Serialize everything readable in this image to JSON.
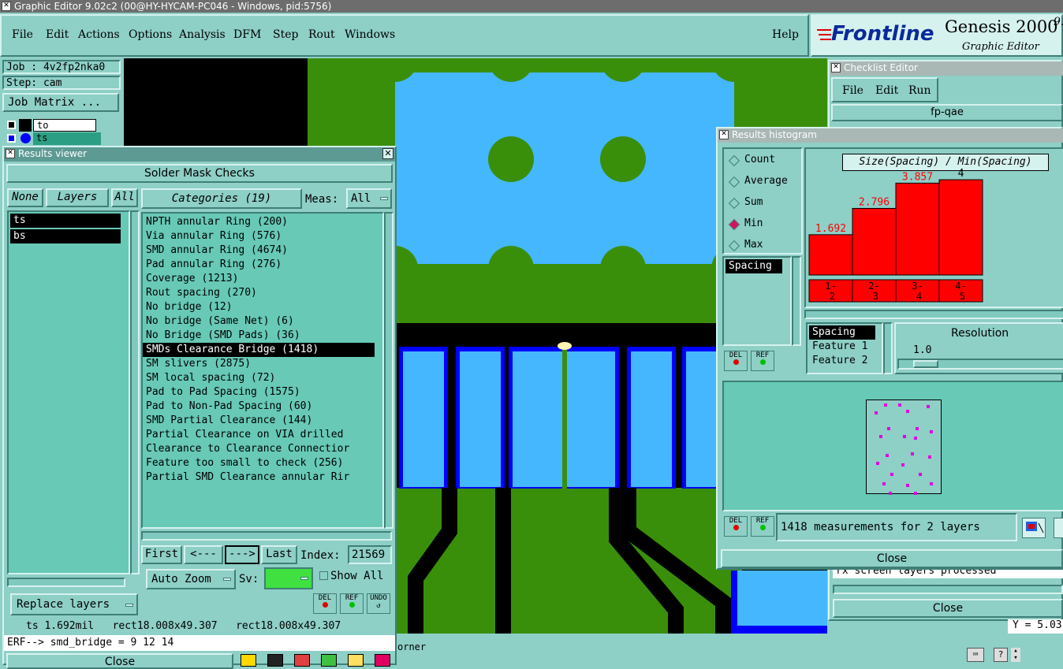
{
  "window": {
    "title": "Graphic Editor 9.02c2 (00@HY-HYCAM-PC046 - Windows, pid:5756)"
  },
  "menu": {
    "items": [
      "File",
      "Edit",
      "Actions",
      "Options",
      "Analysis",
      "DFM",
      "Step",
      "Rout",
      "Windows"
    ],
    "help": "Help"
  },
  "brand": {
    "logo": "Frontline",
    "product": "Genesis 2000",
    "version_fragment": "9.",
    "subtitle": "Graphic Editor"
  },
  "job_panel": {
    "job": "Job : 4v2fp2nka0",
    "step": "Step: cam",
    "matrix_button": "Job Matrix ...",
    "layer1": "to",
    "layer2": "ts"
  },
  "results_viewer": {
    "title": "Results viewer",
    "header": "Solder Mask Checks",
    "none_btn": "None",
    "layers_btn": "Layers",
    "all_btn": "All",
    "categories_btn": "Categories (19)",
    "meas_label": "Meas:",
    "meas_value": "All",
    "layers": [
      "ts",
      "bs"
    ],
    "categories": [
      "NPTH annular Ring (200)",
      "Via annular Ring (576)",
      "SMD annular Ring (4674)",
      "Pad annular Ring (276)",
      "Coverage (1213)",
      "Rout spacing (270)",
      "No bridge (12)",
      "No bridge (Same Net) (6)",
      "No Bridge (SMD Pads) (36)",
      "SMDs Clearance Bridge (1418)",
      "SM slivers (2875)",
      "SM local spacing (72)",
      "Pad to Pad Spacing (1575)",
      "Pad to Non-Pad Spacing (60)",
      "SMD Partial Clearance (144)",
      "Partial Clearance on VIA drilled",
      "Clearance to Clearance Connectior",
      "Feature too small to check (256)",
      "Partial SMD Clearance annular Rir"
    ],
    "selected_category_index": 9,
    "first_btn": "First",
    "prev_btn": "<---",
    "next_btn": "--->",
    "last_btn": "Last",
    "index_label": "Index:",
    "index_value": "21569",
    "auto_zoom": "Auto Zoom",
    "sv_label": "Sv:",
    "show_all": "Show All",
    "replace_layers": "Replace layers",
    "del": "DEL",
    "ref": "REF",
    "undo": "UNDO",
    "status_line": "ts 1.692mil   rect18.008x49.307   rect18.008x49.307",
    "erf_line": "ERF--> smd_bridge = 9 12 14",
    "close": "Close"
  },
  "status_bar": {
    "message_fragment": "orner"
  },
  "checklist_editor": {
    "title": "Checklist Editor",
    "menu": [
      "File",
      "Edit",
      "Run"
    ],
    "name": "fp-qae",
    "line_fragment": "rx screen layers processed",
    "close": "Close",
    "coord_fragment": "Y = 5.03"
  },
  "histogram": {
    "title": "Results histogram",
    "modes": [
      "Count",
      "Average",
      "Sum",
      "Min",
      "Max"
    ],
    "selected_mode_index": 3,
    "chart_title": "Size(Spacing) / Min(Spacing)",
    "list_items": [
      "Spacing"
    ],
    "del": "DEL",
    "ref": "REF",
    "attr_items": [
      "Spacing",
      "Feature 1",
      "Feature 2"
    ],
    "resolution_label": "Resolution",
    "resolution_value": "1.0",
    "summary": "1418 measurements for 2 layers",
    "close": "Close"
  },
  "chart_data": {
    "type": "bar",
    "title": "Size(Spacing) / Min(Spacing)",
    "categories": [
      "1-2",
      "2-3",
      "3-4",
      "4-5"
    ],
    "values": [
      1.692,
      2.796,
      3.857,
      4
    ],
    "value_labels": [
      "1.692",
      "2.796",
      "3.857",
      "4"
    ],
    "ylim": [
      0,
      4.3
    ],
    "bar_color": "#ff0000",
    "label_color": "#ff0000"
  },
  "colors": {
    "panel": "#8ecfc6",
    "copper": "#3a8f0a",
    "mask": "#45b7ff",
    "outline": "#0000ff"
  }
}
